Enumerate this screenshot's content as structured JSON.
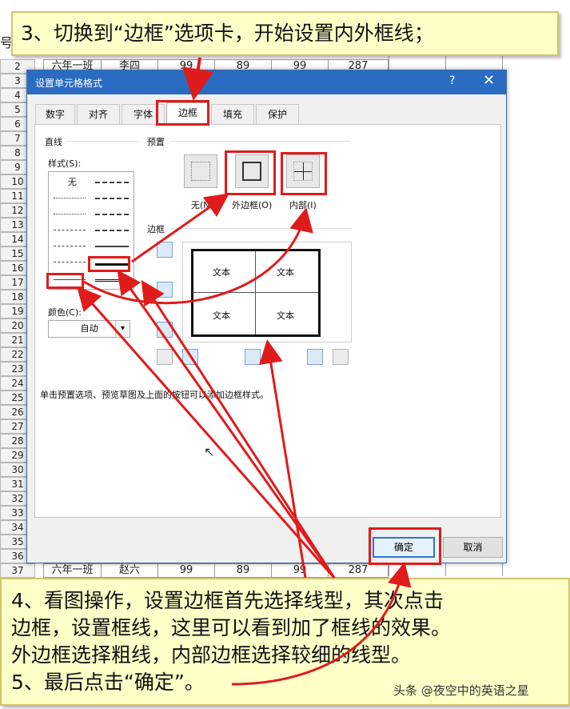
{
  "sheet": {
    "corner_label": "号",
    "row_numbers": [
      "2",
      "3",
      "4",
      "5",
      "6",
      "7",
      "8",
      "9",
      "10",
      "11",
      "12",
      "13",
      "14",
      "15",
      "16",
      "17",
      "18",
      "19",
      "20",
      "21",
      "22",
      "23",
      "24",
      "25",
      "26",
      "27",
      "28",
      "29",
      "30",
      "31",
      "32",
      "33",
      "34",
      "35",
      "36",
      "37"
    ],
    "row2": [
      "六年一班",
      "李四",
      "99",
      "89",
      "99",
      "287"
    ],
    "row37": [
      "六年一班",
      "赵六",
      "99",
      "89",
      "99",
      "287"
    ]
  },
  "dialog": {
    "title": "设置单元格格式",
    "help": "?",
    "close": "✕",
    "tabs": [
      "数字",
      "对齐",
      "字体",
      "边框",
      "填充",
      "保护"
    ],
    "active_tab": "边框",
    "line_group": "直线",
    "style_label": "样式(S):",
    "none_style": "无",
    "color_label": "颜色(C):",
    "color_value": "自动",
    "preset_group": "预置",
    "presets": [
      "无(N)",
      "外边框(O)",
      "内部(I)"
    ],
    "border_group": "边框",
    "preview_text": "文本",
    "hint": "单击预置选项、预览草图及上面的按钮可以添加边框样式。",
    "ok": "确定",
    "cancel": "取消"
  },
  "callouts": {
    "step3": "3、切换到“边框”选项卡，开始设置内外框线；",
    "step4_line1": "4、看图操作，设置边框首先选择线型，其次点击",
    "step4_line2": "边框，设置框线，这里可以看到加了框线的效果。",
    "step4_line3": "外边框选择粗线，内部边框选择较细的线型。",
    "step5": "5、最后点击“确定”。",
    "watermark": "头条 @夜空中的英语之星"
  },
  "colors": {
    "titlebar": "#2b6cc3",
    "callout_bg": "#ffffc8",
    "highlight": "#e01b1b"
  }
}
